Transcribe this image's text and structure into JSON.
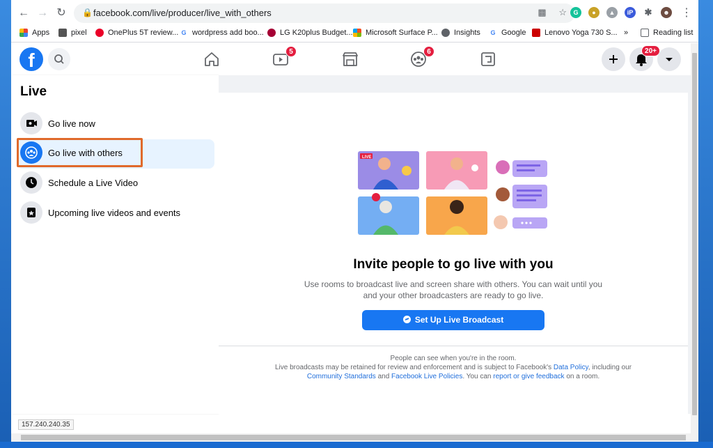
{
  "browser": {
    "url": "facebook.com/live/producer/live_with_others",
    "bookmarks": [
      {
        "label": "Apps",
        "icon": "apps-grid-icon"
      },
      {
        "label": "pixel",
        "icon": "apple-icon"
      },
      {
        "label": "OnePlus 5T review...",
        "icon": "oneplus-icon"
      },
      {
        "label": "wordpress add boo...",
        "icon": "google-icon"
      },
      {
        "label": "LG K20plus Budget...",
        "icon": "lg-icon"
      },
      {
        "label": "Microsoft Surface P...",
        "icon": "microsoft-icon"
      },
      {
        "label": "Insights",
        "icon": "globe-icon"
      },
      {
        "label": "Google",
        "icon": "google-icon"
      },
      {
        "label": "Lenovo Yoga 730 S...",
        "icon": "cnet-icon"
      }
    ],
    "more_bookmarks": "»",
    "reading_list": "Reading list",
    "status_url": "157.240.240.35"
  },
  "header": {
    "logo": "f",
    "watch_badge": "5",
    "groups_badge": "6",
    "notifications_badge": "20+"
  },
  "sidebar": {
    "title": "Live",
    "items": [
      {
        "label": "Go live now",
        "icon": "video-camera-icon"
      },
      {
        "label": "Go live with others",
        "icon": "group-icon",
        "active": true
      },
      {
        "label": "Schedule a Live Video",
        "icon": "clock-icon"
      },
      {
        "label": "Upcoming live videos and events",
        "icon": "calendar-icon"
      }
    ]
  },
  "main": {
    "title": "Invite people to go live with you",
    "description": "Use rooms to broadcast live and screen share with others. You can wait until you and your other broadcasters are ready to go live.",
    "button": "Set Up Live Broadcast",
    "live_tag": "LIVE",
    "footer": {
      "line1": "People can see when you're in the room.",
      "line2_a": "Live broadcasts may be retained for review and enforcement and is subject to Facebook's ",
      "data_policy": "Data Policy",
      "line2_b": ", including our",
      "community_standards": "Community Standards",
      "and": " and ",
      "live_policies": "Facebook Live Policies",
      "line3_a": ". You can ",
      "report": "report or give feedback",
      "line3_b": " on a room."
    }
  },
  "colors": {
    "accent": "#1877f2",
    "badge": "#e41e3f",
    "highlight": "#e06a2b"
  }
}
